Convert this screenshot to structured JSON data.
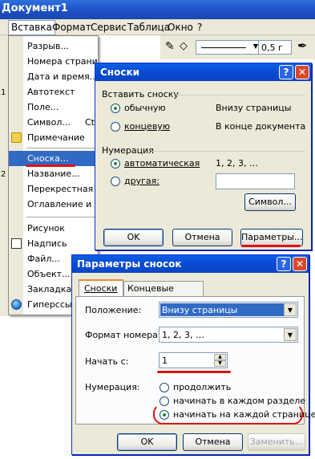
{
  "app": {
    "title": "Документ1",
    "menus": [
      "Вставка",
      "Формат",
      "Сервис",
      "Таблица",
      "Окно",
      "?"
    ],
    "left_marks": [
      "1",
      "2"
    ]
  },
  "toolbar": {
    "line_width": "0,5 г"
  },
  "insert_menu": {
    "items": [
      {
        "label": "Разрыв...",
        "icon": ""
      },
      {
        "label": "Номера страниц",
        "icon": ""
      },
      {
        "label": "Дата и время...",
        "icon": ""
      },
      {
        "label": "Автотекст",
        "icon": ""
      },
      {
        "label": "Поле...",
        "icon": ""
      },
      {
        "label": "Символ...",
        "icon": ""
      },
      {
        "label": "Примечание",
        "icon": "comment-icon"
      },
      {
        "label": "Сноска...",
        "icon": "",
        "highlighted": true
      },
      {
        "label": "Название...",
        "icon": ""
      },
      {
        "label": "Перекрестная с",
        "icon": ""
      },
      {
        "label": "Оглавление и у",
        "icon": ""
      },
      {
        "label": "Рисунок",
        "icon": ""
      },
      {
        "label": "Надпись",
        "icon": "textbox-icon"
      },
      {
        "label": "Файл...",
        "icon": ""
      },
      {
        "label": "Объект...",
        "icon": ""
      },
      {
        "label": "Закладка...",
        "icon": ""
      },
      {
        "label": "Гиперссыл",
        "icon": "globe-icon"
      }
    ],
    "cut_suffix": "Ct"
  },
  "footnote_dialog": {
    "title": "Сноски",
    "insert_heading": "Вставить сноску",
    "opt_regular": "обычную",
    "opt_regular_pos": "Внизу страницы",
    "opt_end": "концевую",
    "opt_end_pos": "В конце документа",
    "numbering_heading": "Нумерация",
    "opt_auto": "автоматическая",
    "auto_sample": "1, 2, 3, …",
    "opt_other": "другая:",
    "other_value": "",
    "symbol_button": "Символ...",
    "ok": "OK",
    "cancel": "Отмена",
    "options": "Параметры..."
  },
  "options_dialog": {
    "title": "Параметры сносок",
    "tab_footnotes": "Сноски",
    "tab_endnotes": "Концевые сноски",
    "position_label": "Положение:",
    "position_value": "Внизу страницы",
    "format_label": "Формат номера:",
    "format_value": "1, 2, 3, …",
    "start_label": "Начать с:",
    "start_value": "1",
    "numbering_label": "Нумерация:",
    "opt_continue": "продолжить",
    "opt_each_section": "начинать в каждом разделе",
    "opt_each_page": "начинать на каждой странице",
    "ok": "OK",
    "cancel": "Отмена",
    "replace": "Заменить..."
  },
  "colors": {
    "title_bar": "#0a5fe4",
    "highlight": "#316ac5",
    "annotation_red": "#e01010"
  }
}
